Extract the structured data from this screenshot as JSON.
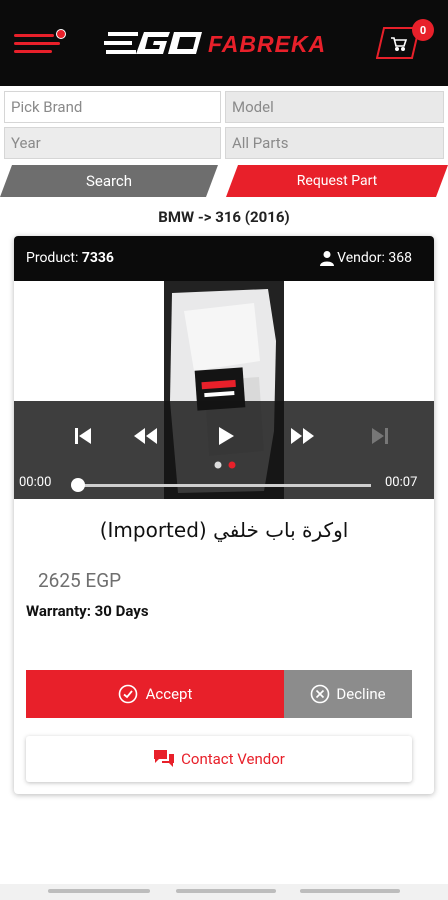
{
  "app": {
    "logo_text": "EGO FABREKA",
    "cart_count": "0"
  },
  "filters": {
    "brand_placeholder": "Pick Brand",
    "model_placeholder": "Model",
    "year_placeholder": "Year",
    "parts_placeholder": "All Parts"
  },
  "actions": {
    "search_label": "Search",
    "request_label": "Request Part"
  },
  "breadcrumb": "BMW -> 316 (2016)",
  "card": {
    "product_label": "Product:",
    "product_id": "7336",
    "vendor_label": "Vendor: 368",
    "video": {
      "current_time": "00:00",
      "duration": "00:07",
      "progress": 0,
      "slide_count": 2,
      "active_slide": 2
    },
    "title": "اوكرة باب خلفي (Imported)",
    "price": "2625 EGP",
    "warranty": "Warranty: 30 Days",
    "accept_label": "Accept",
    "decline_label": "Decline",
    "contact_label": "Contact Vendor"
  },
  "colors": {
    "accent": "#e8202a",
    "header_bg": "#0b0b0b",
    "search_bg": "#6e6e6e",
    "decline_bg": "#8c8c8c"
  }
}
